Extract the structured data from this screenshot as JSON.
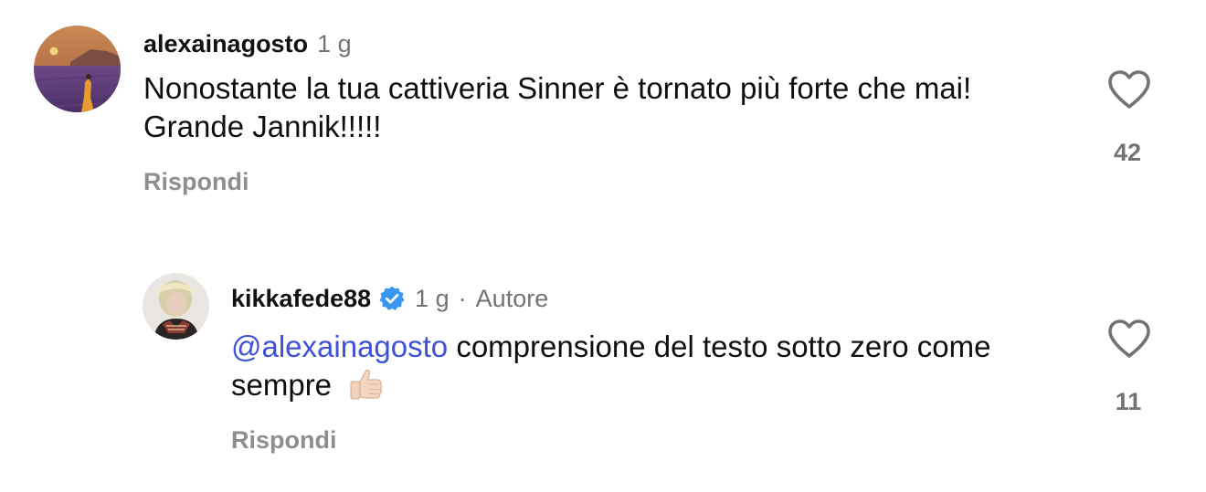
{
  "comments": [
    {
      "username": "alexainagosto",
      "time": "1 g",
      "text": "Nonostante la tua cattiveria Sinner è tornato più forte che mai!  Grande Jannik!!!!!",
      "reply_label": "Rispondi",
      "likes": "42"
    },
    {
      "username": "kikkafede88",
      "time": "1 g",
      "separator": "·",
      "author_label": "Autore",
      "mention": "@alexainagosto",
      "text": " comprensione del testo sotto zero come sempre",
      "emoji": "thumbs-up-icon",
      "reply_label": "Rispondi",
      "likes": "11"
    }
  ],
  "colors": {
    "mention": "#3f51d8",
    "meta": "#737373",
    "reply": "#8e8e8e",
    "verified": "#3897f0"
  }
}
